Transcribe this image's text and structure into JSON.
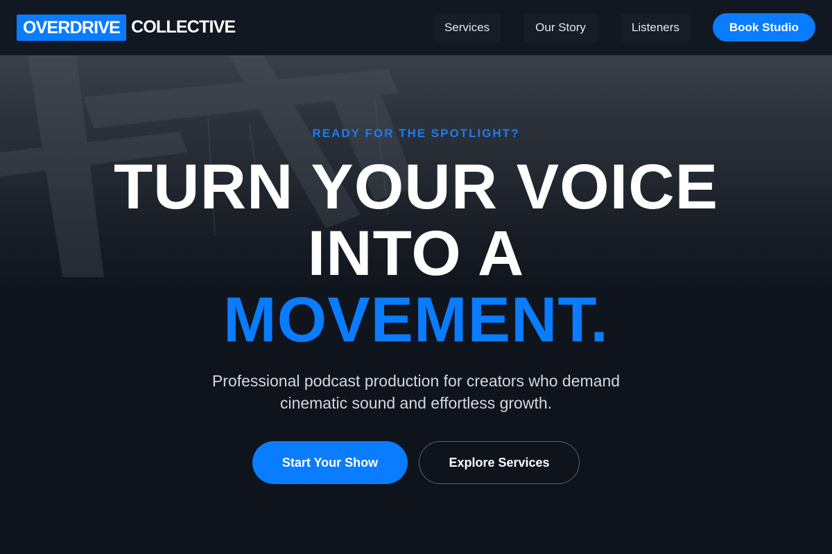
{
  "brand": {
    "logo_part1": "OVERDRIVE",
    "logo_part2": "COLLECTIVE",
    "accent_color": "#0a7cff"
  },
  "nav": {
    "items": [
      {
        "label": "Services"
      },
      {
        "label": "Our Story"
      },
      {
        "label": "Listeners"
      }
    ],
    "cta_label": "Book Studio"
  },
  "hero": {
    "eyebrow": "READY FOR THE SPOTLIGHT?",
    "headline_line1": "TURN YOUR VOICE",
    "headline_line2": "INTO A",
    "headline_accent": "MOVEMENT.",
    "subtitle_line1": "Professional podcast production for creators who demand",
    "subtitle_line2": "cinematic sound and effortless growth.",
    "primary_cta": "Start Your Show",
    "secondary_cta": "Explore Services"
  }
}
